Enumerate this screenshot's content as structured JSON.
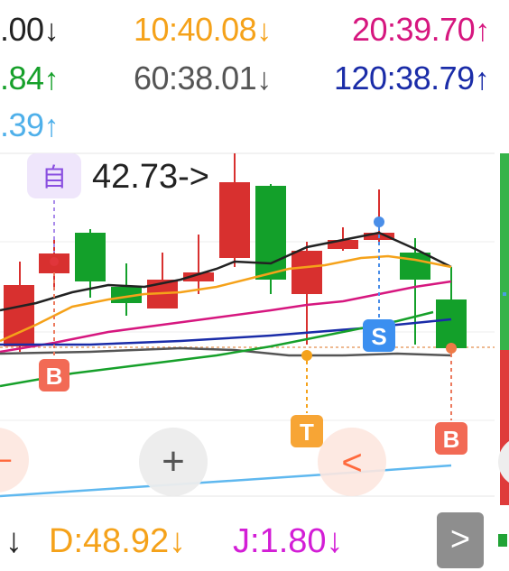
{
  "ma_labels": {
    "row1": [
      {
        "text": ".00",
        "arrow": "↓",
        "color": "#222222"
      },
      {
        "text": "10:40.08",
        "arrow": "↓",
        "color": "#f5a21a"
      },
      {
        "text": "20:39.70",
        "arrow": "↑",
        "color": "#d6177f"
      }
    ],
    "row2": [
      {
        "text": ".84",
        "arrow": "↑",
        "color": "#16a02a"
      },
      {
        "text": "60:38.01",
        "arrow": "↓",
        "color": "#555555"
      },
      {
        "text": "120:38.79",
        "arrow": "↑",
        "color": "#1a2ca8"
      }
    ],
    "row3": [
      {
        "text": ".39",
        "arrow": "↑",
        "color": "#4fb0ea"
      }
    ]
  },
  "chart": {
    "tooltip_icon": "自",
    "price_label": "42.73->",
    "markers": [
      {
        "label": "B",
        "type": "buy"
      },
      {
        "label": "S",
        "type": "sell"
      },
      {
        "label": "T",
        "type": "t"
      },
      {
        "label": "B",
        "type": "buy"
      }
    ],
    "buttons": [
      {
        "name": "prev-button",
        "glyph": "−"
      },
      {
        "name": "zoom-in-button",
        "glyph": "+"
      },
      {
        "name": "back-button",
        "glyph": "<"
      }
    ]
  },
  "indicators": [
    {
      "text": "↓",
      "color": "#222222"
    },
    {
      "text": "D:48.92↓",
      "color": "#f5a21a"
    },
    {
      "text": "J:1.80↓",
      "color": "#d31ed6"
    }
  ],
  "nav": {
    "next_glyph": ">"
  },
  "colors": {
    "up": "#d8302f",
    "down": "#13a02a",
    "accent": "#ff6a3d"
  }
}
